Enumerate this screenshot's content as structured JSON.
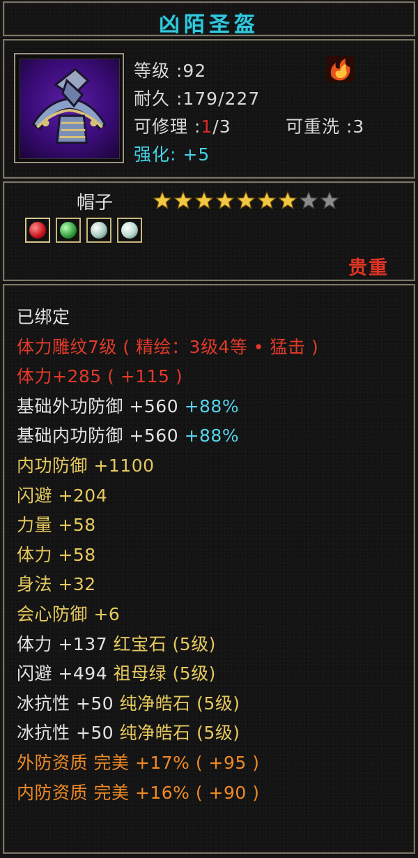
{
  "item": {
    "name": "凶陌圣盔",
    "level_text": "等级 :92",
    "durability_text": "耐久 :179/227",
    "repair_label": "可修理 :",
    "repair_used": "1",
    "repair_total": "/3",
    "rewash_text": "可重洗 :3",
    "enhance_label": "强化: ",
    "enhance_value": "+5",
    "type_label": "帽子",
    "stars_filled": 7,
    "stars_total": 9,
    "rarity": "贵重",
    "icons": {
      "item": "helmet-icon",
      "badge": "flame-sect-icon",
      "gems": [
        "ruby-gem-icon",
        "emerald-gem-icon",
        "pure-crystal-gem-icon",
        "pure-crystal-gem-icon"
      ]
    }
  },
  "colors": {
    "title": "#33c7dc",
    "base_text": "#e2e2e2",
    "red": "#e23a2a",
    "gold": "#e6c95e",
    "cyan": "#55d3e8",
    "orange": "#ef8a26",
    "border": "#7a7566"
  },
  "stats": [
    {
      "text": "已绑定",
      "color": "white"
    },
    {
      "text": "体力雕纹7级 ( 精绘：3级4等 • 猛击 )",
      "color": "red"
    },
    {
      "text": "体力+285 ( +115 )",
      "color": "red"
    },
    {
      "text": "基础外功防御 +560 ",
      "color": "white",
      "extra": "+88%",
      "extra_color": "cyan"
    },
    {
      "text": "基础内功防御 +560 ",
      "color": "white",
      "extra": "+88%",
      "extra_color": "cyan"
    },
    {
      "text": "内功防御 +1100",
      "color": "gold"
    },
    {
      "text": "闪避 +204",
      "color": "gold"
    },
    {
      "text": "力量 +58",
      "color": "gold"
    },
    {
      "text": "体力 +58",
      "color": "gold"
    },
    {
      "text": "身法 +32",
      "color": "gold"
    },
    {
      "text": "会心防御 +6",
      "color": "gold"
    },
    {
      "text": "体力 +137 ",
      "color": "white",
      "extra": "红宝石 (5级)",
      "extra_color": "gold"
    },
    {
      "text": "闪避 +494 ",
      "color": "white",
      "extra": "祖母绿 (5级)",
      "extra_color": "gold"
    },
    {
      "text": "冰抗性 +50 ",
      "color": "white",
      "extra": "纯净皓石 (5级)",
      "extra_color": "gold"
    },
    {
      "text": "冰抗性 +50 ",
      "color": "white",
      "extra": "纯净皓石 (5级)",
      "extra_color": "gold"
    },
    {
      "text": "外防资质  完美 +17% ( +95 )",
      "color": "orange"
    },
    {
      "text": "内防资质  完美 +16% ( +90 )",
      "color": "orange"
    }
  ]
}
